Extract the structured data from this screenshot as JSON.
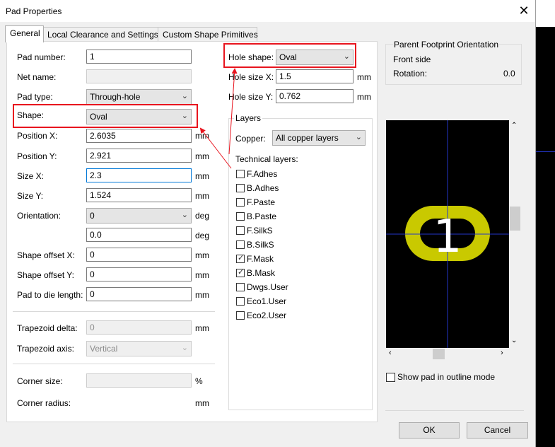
{
  "window": {
    "title": "Pad Properties",
    "close": "✕"
  },
  "tabs": [
    "General",
    "Local Clearance and Settings",
    "Custom Shape Primitives"
  ],
  "left": {
    "pad_number": {
      "label": "Pad number:",
      "value": "1"
    },
    "net_name": {
      "label": "Net name:",
      "value": ""
    },
    "pad_type": {
      "label": "Pad type:",
      "value": "Through-hole"
    },
    "shape": {
      "label": "Shape:",
      "value": "Oval"
    },
    "position_x": {
      "label": "Position X:",
      "value": "2.6035",
      "unit": "mm"
    },
    "position_y": {
      "label": "Position Y:",
      "value": "2.921",
      "unit": "mm"
    },
    "size_x": {
      "label": "Size X:",
      "value": "2.3",
      "unit": "mm"
    },
    "size_y": {
      "label": "Size Y:",
      "value": "1.524",
      "unit": "mm"
    },
    "orientation": {
      "label": "Orientation:",
      "value": "0",
      "unit": "deg"
    },
    "orientation_custom": {
      "value": "0.0",
      "unit": "deg"
    },
    "shape_offset_x": {
      "label": "Shape offset X:",
      "value": "0",
      "unit": "mm"
    },
    "shape_offset_y": {
      "label": "Shape offset Y:",
      "value": "0",
      "unit": "mm"
    },
    "pad_to_die": {
      "label": "Pad to die length:",
      "value": "0",
      "unit": "mm"
    },
    "trapezoid_delta": {
      "label": "Trapezoid delta:",
      "value": "0",
      "unit": "mm"
    },
    "trapezoid_axis": {
      "label": "Trapezoid axis:",
      "value": "Vertical"
    },
    "corner_size": {
      "label": "Corner size:",
      "value": "",
      "unit": "%"
    },
    "corner_radius": {
      "label": "Corner radius:",
      "unit": "mm"
    }
  },
  "hole": {
    "shape": {
      "label": "Hole shape:",
      "value": "Oval"
    },
    "size_x": {
      "label": "Hole size X:",
      "value": "1.5",
      "unit": "mm"
    },
    "size_y": {
      "label": "Hole size Y:",
      "value": "0.762",
      "unit": "mm"
    }
  },
  "layers": {
    "title": "Layers",
    "copper_label": "Copper:",
    "copper_value": "All copper layers",
    "technical_label": "Technical layers:",
    "items": [
      {
        "name": "F.Adhes",
        "checked": false
      },
      {
        "name": "B.Adhes",
        "checked": false
      },
      {
        "name": "F.Paste",
        "checked": false
      },
      {
        "name": "B.Paste",
        "checked": false
      },
      {
        "name": "F.SilkS",
        "checked": false
      },
      {
        "name": "B.SilkS",
        "checked": false
      },
      {
        "name": "F.Mask",
        "checked": true
      },
      {
        "name": "B.Mask",
        "checked": true
      },
      {
        "name": "Dwgs.User",
        "checked": false
      },
      {
        "name": "Eco1.User",
        "checked": false
      },
      {
        "name": "Eco2.User",
        "checked": false
      }
    ]
  },
  "orientation_info": {
    "title": "Parent Footprint Orientation",
    "side": "Front side",
    "rotation_label": "Rotation:",
    "rotation_value": "0.0"
  },
  "preview": {
    "pad_number": "1",
    "pad_color": "#c9c900",
    "crosshair_color": "#2436c8"
  },
  "outline_mode": {
    "label": "Show pad in outline mode",
    "checked": false
  },
  "buttons": {
    "ok": "OK",
    "cancel": "Cancel"
  },
  "annotations": {
    "highlight_color": "#e8141e"
  }
}
